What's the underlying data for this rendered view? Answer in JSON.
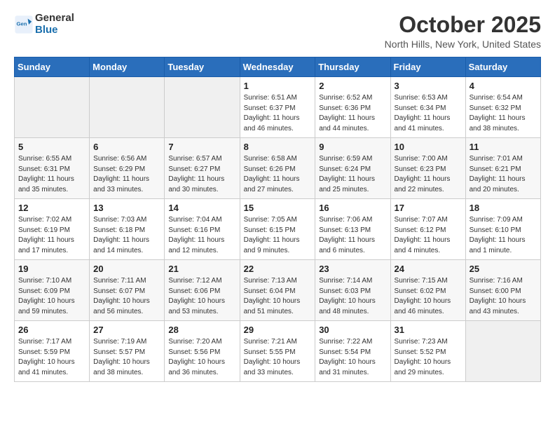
{
  "header": {
    "logo_general": "General",
    "logo_blue": "Blue",
    "month_title": "October 2025",
    "location": "North Hills, New York, United States"
  },
  "weekdays": [
    "Sunday",
    "Monday",
    "Tuesday",
    "Wednesday",
    "Thursday",
    "Friday",
    "Saturday"
  ],
  "weeks": [
    [
      {
        "day": "",
        "info": ""
      },
      {
        "day": "",
        "info": ""
      },
      {
        "day": "",
        "info": ""
      },
      {
        "day": "1",
        "info": "Sunrise: 6:51 AM\nSunset: 6:37 PM\nDaylight: 11 hours\nand 46 minutes."
      },
      {
        "day": "2",
        "info": "Sunrise: 6:52 AM\nSunset: 6:36 PM\nDaylight: 11 hours\nand 44 minutes."
      },
      {
        "day": "3",
        "info": "Sunrise: 6:53 AM\nSunset: 6:34 PM\nDaylight: 11 hours\nand 41 minutes."
      },
      {
        "day": "4",
        "info": "Sunrise: 6:54 AM\nSunset: 6:32 PM\nDaylight: 11 hours\nand 38 minutes."
      }
    ],
    [
      {
        "day": "5",
        "info": "Sunrise: 6:55 AM\nSunset: 6:31 PM\nDaylight: 11 hours\nand 35 minutes."
      },
      {
        "day": "6",
        "info": "Sunrise: 6:56 AM\nSunset: 6:29 PM\nDaylight: 11 hours\nand 33 minutes."
      },
      {
        "day": "7",
        "info": "Sunrise: 6:57 AM\nSunset: 6:27 PM\nDaylight: 11 hours\nand 30 minutes."
      },
      {
        "day": "8",
        "info": "Sunrise: 6:58 AM\nSunset: 6:26 PM\nDaylight: 11 hours\nand 27 minutes."
      },
      {
        "day": "9",
        "info": "Sunrise: 6:59 AM\nSunset: 6:24 PM\nDaylight: 11 hours\nand 25 minutes."
      },
      {
        "day": "10",
        "info": "Sunrise: 7:00 AM\nSunset: 6:23 PM\nDaylight: 11 hours\nand 22 minutes."
      },
      {
        "day": "11",
        "info": "Sunrise: 7:01 AM\nSunset: 6:21 PM\nDaylight: 11 hours\nand 20 minutes."
      }
    ],
    [
      {
        "day": "12",
        "info": "Sunrise: 7:02 AM\nSunset: 6:19 PM\nDaylight: 11 hours\nand 17 minutes."
      },
      {
        "day": "13",
        "info": "Sunrise: 7:03 AM\nSunset: 6:18 PM\nDaylight: 11 hours\nand 14 minutes."
      },
      {
        "day": "14",
        "info": "Sunrise: 7:04 AM\nSunset: 6:16 PM\nDaylight: 11 hours\nand 12 minutes."
      },
      {
        "day": "15",
        "info": "Sunrise: 7:05 AM\nSunset: 6:15 PM\nDaylight: 11 hours\nand 9 minutes."
      },
      {
        "day": "16",
        "info": "Sunrise: 7:06 AM\nSunset: 6:13 PM\nDaylight: 11 hours\nand 6 minutes."
      },
      {
        "day": "17",
        "info": "Sunrise: 7:07 AM\nSunset: 6:12 PM\nDaylight: 11 hours\nand 4 minutes."
      },
      {
        "day": "18",
        "info": "Sunrise: 7:09 AM\nSunset: 6:10 PM\nDaylight: 11 hours\nand 1 minute."
      }
    ],
    [
      {
        "day": "19",
        "info": "Sunrise: 7:10 AM\nSunset: 6:09 PM\nDaylight: 10 hours\nand 59 minutes."
      },
      {
        "day": "20",
        "info": "Sunrise: 7:11 AM\nSunset: 6:07 PM\nDaylight: 10 hours\nand 56 minutes."
      },
      {
        "day": "21",
        "info": "Sunrise: 7:12 AM\nSunset: 6:06 PM\nDaylight: 10 hours\nand 53 minutes."
      },
      {
        "day": "22",
        "info": "Sunrise: 7:13 AM\nSunset: 6:04 PM\nDaylight: 10 hours\nand 51 minutes."
      },
      {
        "day": "23",
        "info": "Sunrise: 7:14 AM\nSunset: 6:03 PM\nDaylight: 10 hours\nand 48 minutes."
      },
      {
        "day": "24",
        "info": "Sunrise: 7:15 AM\nSunset: 6:02 PM\nDaylight: 10 hours\nand 46 minutes."
      },
      {
        "day": "25",
        "info": "Sunrise: 7:16 AM\nSunset: 6:00 PM\nDaylight: 10 hours\nand 43 minutes."
      }
    ],
    [
      {
        "day": "26",
        "info": "Sunrise: 7:17 AM\nSunset: 5:59 PM\nDaylight: 10 hours\nand 41 minutes."
      },
      {
        "day": "27",
        "info": "Sunrise: 7:19 AM\nSunset: 5:57 PM\nDaylight: 10 hours\nand 38 minutes."
      },
      {
        "day": "28",
        "info": "Sunrise: 7:20 AM\nSunset: 5:56 PM\nDaylight: 10 hours\nand 36 minutes."
      },
      {
        "day": "29",
        "info": "Sunrise: 7:21 AM\nSunset: 5:55 PM\nDaylight: 10 hours\nand 33 minutes."
      },
      {
        "day": "30",
        "info": "Sunrise: 7:22 AM\nSunset: 5:54 PM\nDaylight: 10 hours\nand 31 minutes."
      },
      {
        "day": "31",
        "info": "Sunrise: 7:23 AM\nSunset: 5:52 PM\nDaylight: 10 hours\nand 29 minutes."
      },
      {
        "day": "",
        "info": ""
      }
    ]
  ]
}
